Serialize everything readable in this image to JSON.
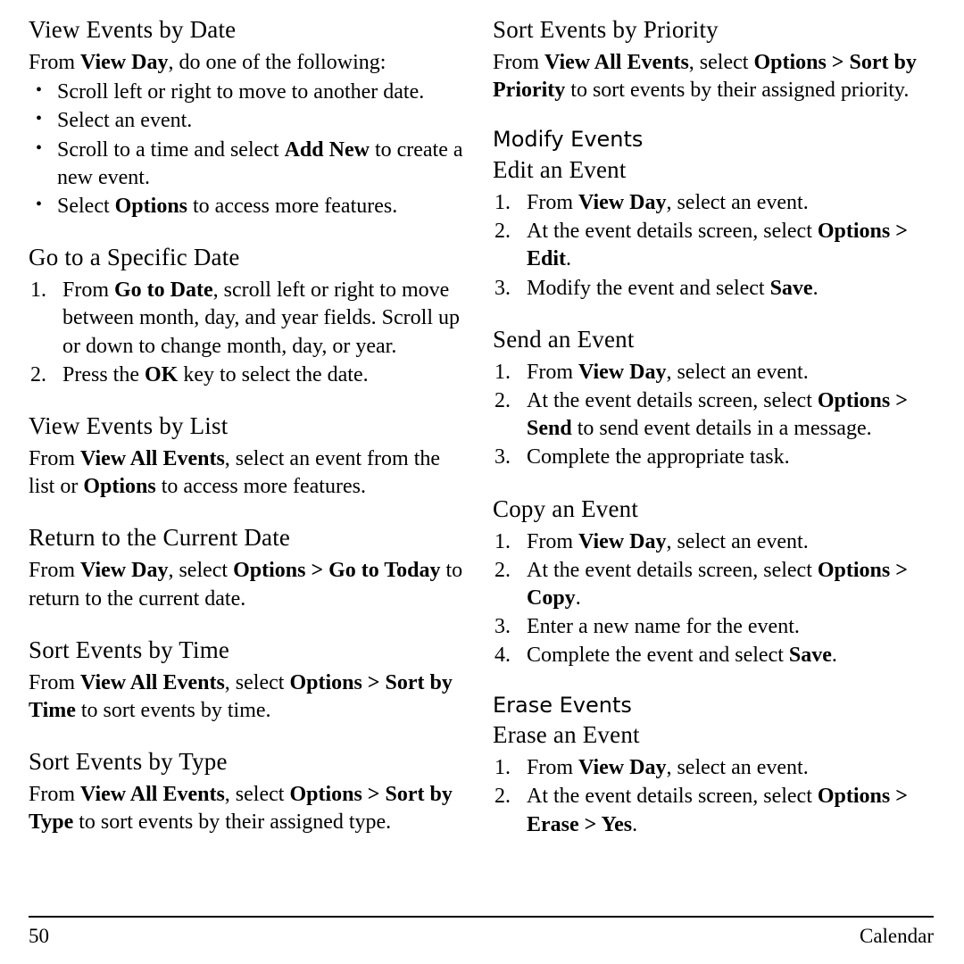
{
  "page": {
    "number": "50",
    "chapter": "Calendar"
  },
  "left_column": {
    "s1": {
      "heading": "View Events by Date",
      "intro_pre": "From ",
      "intro_bold": "View Day",
      "intro_post": ", do one of the following:",
      "bullets": [
        {
          "pre": "Scroll left or right to move to another date.",
          "bold": "",
          "post": ""
        },
        {
          "pre": "Select an event.",
          "bold": "",
          "post": ""
        },
        {
          "pre": "Scroll to a time and select ",
          "bold": "Add New",
          "post": " to create a new event."
        },
        {
          "pre": "Select ",
          "bold": "Options",
          "post": " to access more features."
        }
      ]
    },
    "s2": {
      "heading": "Go to a Specific Date",
      "steps": [
        {
          "pre": "From ",
          "bold": "Go to Date",
          "post": ", scroll left or right to move between month, day, and year fields. Scroll up or down to change month, day, or year."
        },
        {
          "pre": "Press the ",
          "bold": "OK",
          "post": " key to select the date."
        }
      ]
    },
    "s3": {
      "heading": "View Events by List",
      "line_pre": "From ",
      "line_b1": "View All Events",
      "line_mid": ", select an event from the list or ",
      "line_b2": "Options",
      "line_post": " to access more features."
    },
    "s4": {
      "heading": "Return to the Current Date",
      "line_pre": "From ",
      "line_b1": "View Day",
      "line_mid": ", select ",
      "line_b2": "Options > Go to Today",
      "line_post": " to return to the current date."
    },
    "s5": {
      "heading": "Sort Events by Time",
      "line_pre": "From ",
      "line_b1": "View All Events",
      "line_mid": ", select ",
      "line_b2": "Options > Sort by Time",
      "line_post": " to sort events by time."
    },
    "s6": {
      "heading": "Sort Events by Type",
      "line_pre": "From ",
      "line_b1": "View All Events",
      "line_mid": ", select ",
      "line_b2": "Options > Sort by Type",
      "line_post": " to sort events by their assigned type."
    }
  },
  "right_column": {
    "s1": {
      "heading": "Sort Events by Priority",
      "line_pre": "From ",
      "line_b1": "View All Events",
      "line_mid": ", select ",
      "line_b2": "Options > Sort by Priority",
      "line_post": " to sort events by their assigned priority."
    },
    "s2": {
      "heading": "Modify Events",
      "sub1": {
        "heading": "Edit an Event",
        "steps": [
          {
            "pre": "From ",
            "bold": "View Day",
            "post": ", select an event."
          },
          {
            "pre": "At the event details screen, select ",
            "bold": "Options > Edit",
            "post": "."
          },
          {
            "pre": "Modify the event and select ",
            "bold": "Save",
            "post": "."
          }
        ]
      },
      "sub2": {
        "heading": "Send an Event",
        "steps": [
          {
            "pre": "From ",
            "bold": "View Day",
            "post": ", select an event."
          },
          {
            "pre": "At the event details screen, select ",
            "bold": "Options > Send",
            "post": " to send event details in a message."
          },
          {
            "pre": "Complete the appropriate task.",
            "bold": "",
            "post": ""
          }
        ]
      },
      "sub3": {
        "heading": "Copy an Event",
        "steps": [
          {
            "pre": "From ",
            "bold": "View Day",
            "post": ", select an event."
          },
          {
            "pre": "At the event details screen, select ",
            "bold": "Options > Copy",
            "post": "."
          },
          {
            "pre": "Enter a new name for the event.",
            "bold": "",
            "post": ""
          },
          {
            "pre": "Complete the event and select ",
            "bold": "Save",
            "post": "."
          }
        ]
      }
    },
    "s3": {
      "heading": "Erase Events",
      "sub1": {
        "heading": "Erase an Event",
        "steps": [
          {
            "pre": "From ",
            "bold": "View Day",
            "post": ", select an event."
          },
          {
            "pre": "At the event details screen, select ",
            "bold": "Options > Erase > Yes",
            "post": "."
          }
        ]
      }
    }
  }
}
